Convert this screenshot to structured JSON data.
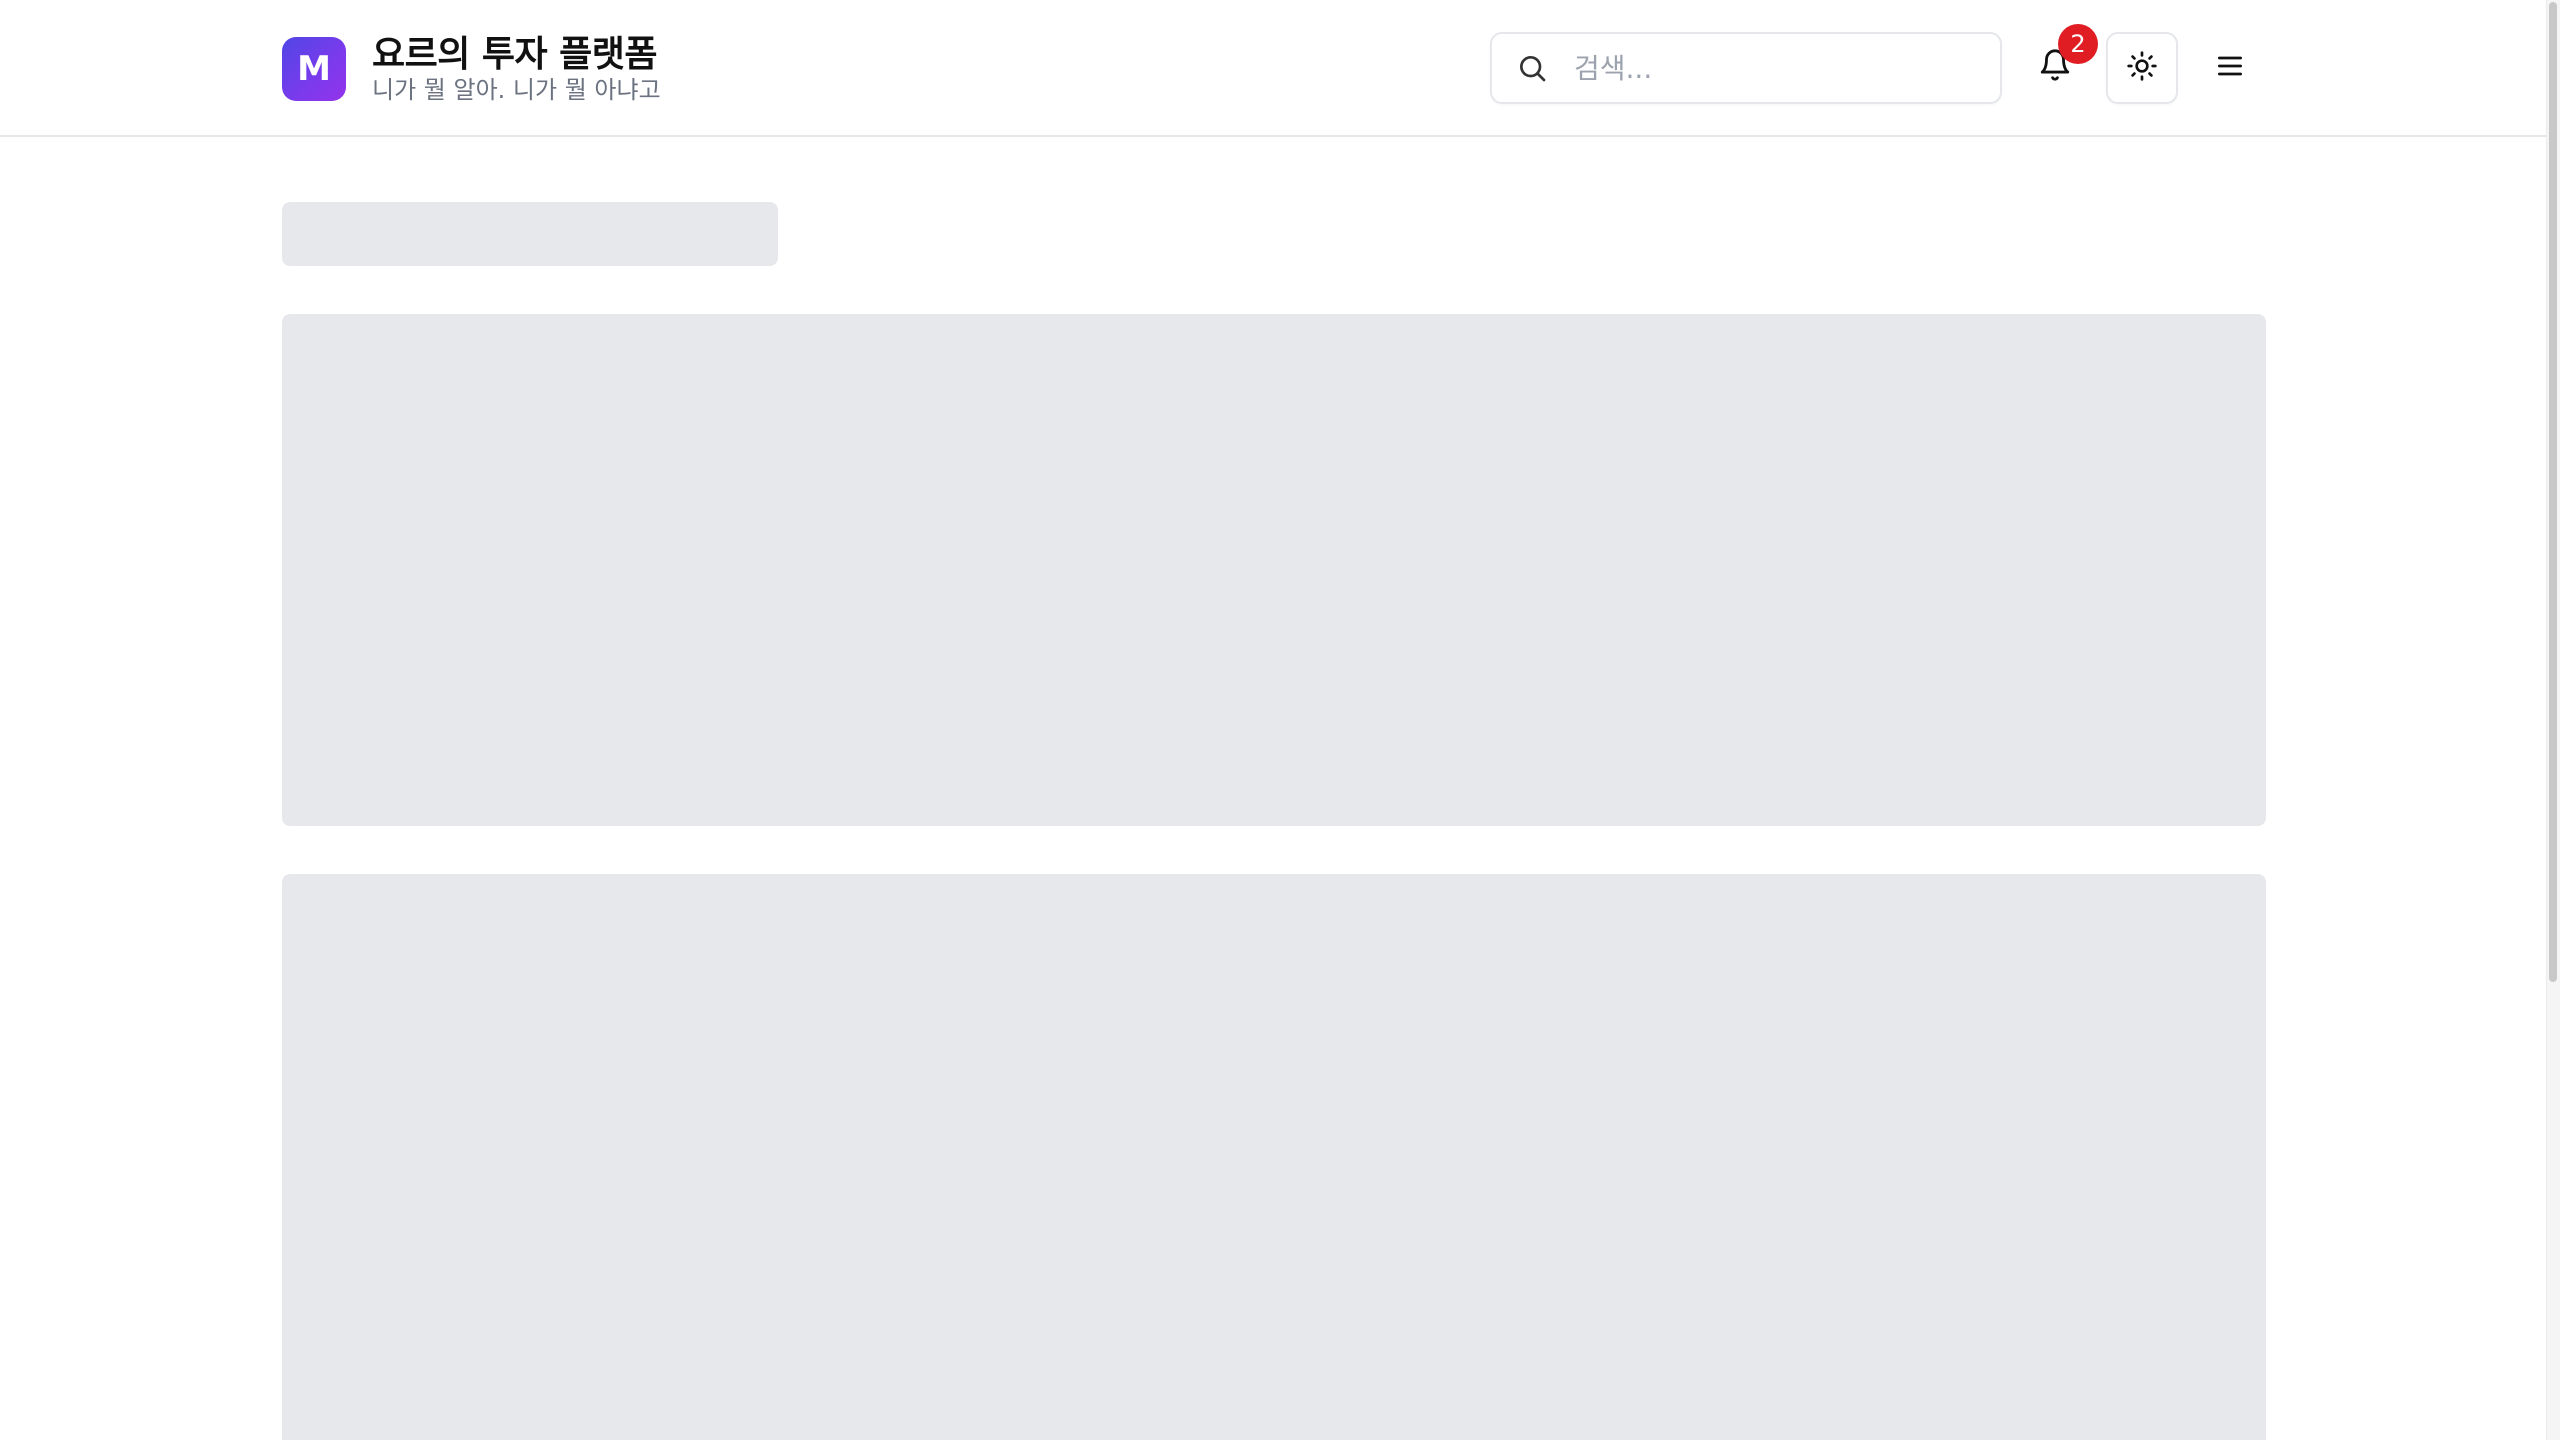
{
  "header": {
    "logo_letter": "M",
    "title": "요르의 투자 플랫폼",
    "subtitle": "니가 뭘 알아. 니가 뭘 아냐고",
    "search_placeholder": "검색...",
    "notification_count": "2",
    "icons": {
      "search": "search-icon",
      "notifications": "bell-icon",
      "theme": "sun-icon",
      "menu": "hamburger-menu-icon"
    }
  },
  "colors": {
    "logo_gradient_start": "#4f46e5",
    "logo_gradient_end": "#9333ea",
    "badge": "#e11d24",
    "skeleton": "#e7e8eb",
    "border": "#e5e7eb"
  },
  "main": {
    "state": "loading"
  }
}
